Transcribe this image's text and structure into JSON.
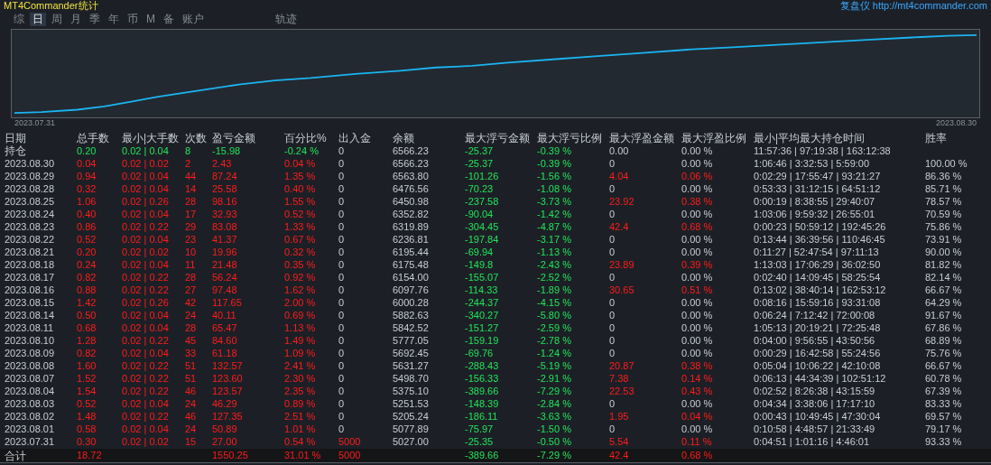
{
  "header": {
    "title": "MT4Commander统计",
    "link": "复盘仪 http://mt4commander.com"
  },
  "tabs": [
    {
      "label": "综",
      "selected": false
    },
    {
      "label": "日",
      "selected": true
    },
    {
      "label": "周",
      "selected": false
    },
    {
      "label": "月",
      "selected": false
    },
    {
      "label": "季",
      "selected": false
    },
    {
      "label": "年",
      "selected": false
    },
    {
      "label": "币",
      "selected": false
    },
    {
      "label": "M",
      "selected": false
    },
    {
      "label": "备",
      "selected": false
    },
    {
      "label": "账户",
      "selected": false
    },
    {
      "label": "轨迹",
      "selected": false
    }
  ],
  "chart": {
    "start_label": "2023.07.31",
    "end_label": "2023.08.30"
  },
  "table": {
    "columns": [
      "日期",
      "总手数",
      "最小|大手数",
      "次数",
      "盈亏金额",
      "百分比%",
      "出入金",
      "余额",
      "最大浮亏金额",
      "最大浮亏比例",
      "最大浮盈金额",
      "最大浮盈比例",
      "最小|平均最大持仓时间",
      "胜率"
    ],
    "rows": [
      {
        "kind": "open",
        "float_profit": false,
        "cash_flow": false,
        "cells": [
          "持仓",
          "0.20",
          "0.02 | 0.04",
          "8",
          "-15.98",
          "-0.24 %",
          "0",
          "6566.23",
          "-25.37",
          "-0.39 %",
          "0.00",
          "0.00 %",
          "11:57:36 | 97:19:38 | 163:12:38",
          ""
        ]
      },
      {
        "kind": "day",
        "float_profit": false,
        "cash_flow": false,
        "cells": [
          "2023.08.30",
          "0.04",
          "0.02 | 0.02",
          "2",
          "2.43",
          "0.04 %",
          "0",
          "6566.23",
          "-25.37",
          "-0.39 %",
          "0",
          "0.00 %",
          "1:06:46 | 3:32:53 | 5:59:00",
          "100.00 %"
        ]
      },
      {
        "kind": "day",
        "float_profit": true,
        "cash_flow": false,
        "cells": [
          "2023.08.29",
          "0.94",
          "0.02 | 0.04",
          "44",
          "87.24",
          "1.35 %",
          "0",
          "6563.80",
          "-101.26",
          "-1.56 %",
          "4.04",
          "0.06 %",
          "0:02:29 | 17:55:47 | 93:21:27",
          "86.36 %"
        ]
      },
      {
        "kind": "day",
        "float_profit": false,
        "cash_flow": false,
        "cells": [
          "2023.08.28",
          "0.32",
          "0.02 | 0.04",
          "14",
          "25.58",
          "0.40 %",
          "0",
          "6476.56",
          "-70.23",
          "-1.08 %",
          "0",
          "0.00 %",
          "0:53:33 | 31:12:15 | 64:51:12",
          "85.71 %"
        ]
      },
      {
        "kind": "day",
        "float_profit": true,
        "cash_flow": false,
        "cells": [
          "2023.08.25",
          "1.06",
          "0.02 | 0.26",
          "28",
          "98.16",
          "1.55 %",
          "0",
          "6450.98",
          "-237.58",
          "-3.73 %",
          "23.92",
          "0.38 %",
          "0:00:19 | 8:38:55 | 29:40:07",
          "78.57 %"
        ]
      },
      {
        "kind": "day",
        "float_profit": false,
        "cash_flow": false,
        "cells": [
          "2023.08.24",
          "0.40",
          "0.02 | 0.04",
          "17",
          "32.93",
          "0.52 %",
          "0",
          "6352.82",
          "-90.04",
          "-1.42 %",
          "0",
          "0.00 %",
          "1:03:06 | 9:59:32 | 26:55:01",
          "70.59 %"
        ]
      },
      {
        "kind": "day",
        "float_profit": true,
        "cash_flow": false,
        "cells": [
          "2023.08.23",
          "0.86",
          "0.02 | 0.22",
          "29",
          "83.08",
          "1.33 %",
          "0",
          "6319.89",
          "-304.45",
          "-4.87 %",
          "42.4",
          "0.68 %",
          "0:00:23 | 50:59:12 | 192:45:26",
          "75.86 %"
        ]
      },
      {
        "kind": "day",
        "float_profit": false,
        "cash_flow": false,
        "cells": [
          "2023.08.22",
          "0.52",
          "0.02 | 0.04",
          "23",
          "41.37",
          "0.67 %",
          "0",
          "6236.81",
          "-197.84",
          "-3.17 %",
          "0",
          "0.00 %",
          "0:13:44 | 36:39:56 | 110:46:45",
          "73.91 %"
        ]
      },
      {
        "kind": "day",
        "float_profit": false,
        "cash_flow": false,
        "cells": [
          "2023.08.21",
          "0.20",
          "0.02 | 0.02",
          "10",
          "19.96",
          "0.32 %",
          "0",
          "6195.44",
          "-69.94",
          "-1.13 %",
          "0",
          "0.00 %",
          "0:11:27 | 52:47:54 | 97:11:13",
          "90.00 %"
        ]
      },
      {
        "kind": "day",
        "float_profit": true,
        "cash_flow": false,
        "cells": [
          "2023.08.18",
          "0.24",
          "0.02 | 0.04",
          "11",
          "21.48",
          "0.35 %",
          "0",
          "6175.48",
          "-149.8",
          "-2.43 %",
          "23.89",
          "0.39 %",
          "1:13:03 | 17:06:29 | 36:02:50",
          "81.82 %"
        ]
      },
      {
        "kind": "day",
        "float_profit": false,
        "cash_flow": false,
        "cells": [
          "2023.08.17",
          "0.82",
          "0.02 | 0.22",
          "28",
          "56.24",
          "0.92 %",
          "0",
          "6154.00",
          "-155.07",
          "-2.52 %",
          "0",
          "0.00 %",
          "0:02:40 | 14:09:45 | 58:25:54",
          "82.14 %"
        ]
      },
      {
        "kind": "day",
        "float_profit": true,
        "cash_flow": false,
        "cells": [
          "2023.08.16",
          "0.88",
          "0.02 | 0.22",
          "27",
          "97.48",
          "1.62 %",
          "0",
          "6097.76",
          "-114.33",
          "-1.89 %",
          "30.65",
          "0.51 %",
          "0:13:02 | 38:40:14 | 162:53:12",
          "66.67 %"
        ]
      },
      {
        "kind": "day",
        "float_profit": false,
        "cash_flow": false,
        "cells": [
          "2023.08.15",
          "1.42",
          "0.02 | 0.26",
          "42",
          "117.65",
          "2.00 %",
          "0",
          "6000.28",
          "-244.37",
          "-4.15 %",
          "0",
          "0.00 %",
          "0:08:16 | 15:59:16 | 93:31:08",
          "64.29 %"
        ]
      },
      {
        "kind": "day",
        "float_profit": false,
        "cash_flow": false,
        "cells": [
          "2023.08.14",
          "0.50",
          "0.02 | 0.04",
          "24",
          "40.11",
          "0.69 %",
          "0",
          "5882.63",
          "-340.27",
          "-5.80 %",
          "0",
          "0.00 %",
          "0:06:24 | 7:12:42 | 72:00:08",
          "91.67 %"
        ]
      },
      {
        "kind": "day",
        "float_profit": false,
        "cash_flow": false,
        "cells": [
          "2023.08.11",
          "0.68",
          "0.02 | 0.04",
          "28",
          "65.47",
          "1.13 %",
          "0",
          "5842.52",
          "-151.27",
          "-2.59 %",
          "0",
          "0.00 %",
          "1:05:13 | 20:19:21 | 72:25:48",
          "67.86 %"
        ]
      },
      {
        "kind": "day",
        "float_profit": false,
        "cash_flow": false,
        "cells": [
          "2023.08.10",
          "1.28",
          "0.02 | 0.22",
          "45",
          "84.60",
          "1.49 %",
          "0",
          "5777.05",
          "-159.19",
          "-2.78 %",
          "0",
          "0.00 %",
          "0:04:00 | 9:56:55 | 43:50:56",
          "68.89 %"
        ]
      },
      {
        "kind": "day",
        "float_profit": false,
        "cash_flow": false,
        "cells": [
          "2023.08.09",
          "0.82",
          "0.02 | 0.04",
          "33",
          "61.18",
          "1.09 %",
          "0",
          "5692.45",
          "-69.76",
          "-1.24 %",
          "0",
          "0.00 %",
          "0:00:29 | 16:42:58 | 55:24:56",
          "75.76 %"
        ]
      },
      {
        "kind": "day",
        "float_profit": true,
        "cash_flow": false,
        "cells": [
          "2023.08.08",
          "1.60",
          "0.02 | 0.22",
          "51",
          "132.57",
          "2.41 %",
          "0",
          "5631.27",
          "-288.43",
          "-5.19 %",
          "20.87",
          "0.38 %",
          "0:05:04 | 10:06:22 | 42:10:08",
          "66.67 %"
        ]
      },
      {
        "kind": "day",
        "float_profit": true,
        "cash_flow": false,
        "cells": [
          "2023.08.07",
          "1.52",
          "0.02 | 0.22",
          "51",
          "123.60",
          "2.30 %",
          "0",
          "5498.70",
          "-156.33",
          "-2.91 %",
          "7.38",
          "0.14 %",
          "0:06:13 | 44:34:39 | 102:51:12",
          "60.78 %"
        ]
      },
      {
        "kind": "day",
        "float_profit": true,
        "cash_flow": false,
        "cells": [
          "2023.08.04",
          "1.54",
          "0.02 | 0.22",
          "46",
          "123.57",
          "2.35 %",
          "0",
          "5375.10",
          "-389.66",
          "-7.29 %",
          "22.53",
          "0.43 %",
          "0:02:52 | 8:26:38 | 43:15:59",
          "67.39 %"
        ]
      },
      {
        "kind": "day",
        "float_profit": false,
        "cash_flow": false,
        "cells": [
          "2023.08.03",
          "0.52",
          "0.02 | 0.04",
          "24",
          "46.29",
          "0.89 %",
          "0",
          "5251.53",
          "-148.39",
          "-2.84 %",
          "0",
          "0.00 %",
          "0:04:34 | 3:38:06 | 17:17:10",
          "83.33 %"
        ]
      },
      {
        "kind": "day",
        "float_profit": true,
        "cash_flow": false,
        "cells": [
          "2023.08.02",
          "1.48",
          "0.02 | 0.22",
          "46",
          "127.35",
          "2.51 %",
          "0",
          "5205.24",
          "-186.11",
          "-3.63 %",
          "1.95",
          "0.04 %",
          "0:00:43 | 10:49:45 | 47:30:04",
          "69.57 %"
        ]
      },
      {
        "kind": "day",
        "float_profit": false,
        "cash_flow": false,
        "cells": [
          "2023.08.01",
          "0.58",
          "0.02 | 0.04",
          "24",
          "50.89",
          "1.01 %",
          "0",
          "5077.89",
          "-75.97",
          "-1.50 %",
          "0",
          "0.00 %",
          "0:10:58 | 4:48:57 | 21:33:49",
          "79.17 %"
        ]
      },
      {
        "kind": "day",
        "float_profit": true,
        "cash_flow": true,
        "cells": [
          "2023.07.31",
          "0.30",
          "0.02 | 0.02",
          "15",
          "27.00",
          "0.54 %",
          "5000",
          "5027.00",
          "-25.35",
          "-0.50 %",
          "5.54",
          "0.11 %",
          "0:04:51 | 1:01:16 | 4:46:01",
          "93.33 %"
        ]
      }
    ],
    "total": {
      "label": "合计",
      "lots": "18.72",
      "pnl": "1550.25",
      "pct": "31.01 %",
      "cash": "5000",
      "max_loss": "-389.66",
      "max_loss_pct": "-7.29 %",
      "max_profit": "42.4",
      "max_profit_pct": "0.68 %"
    }
  }
}
